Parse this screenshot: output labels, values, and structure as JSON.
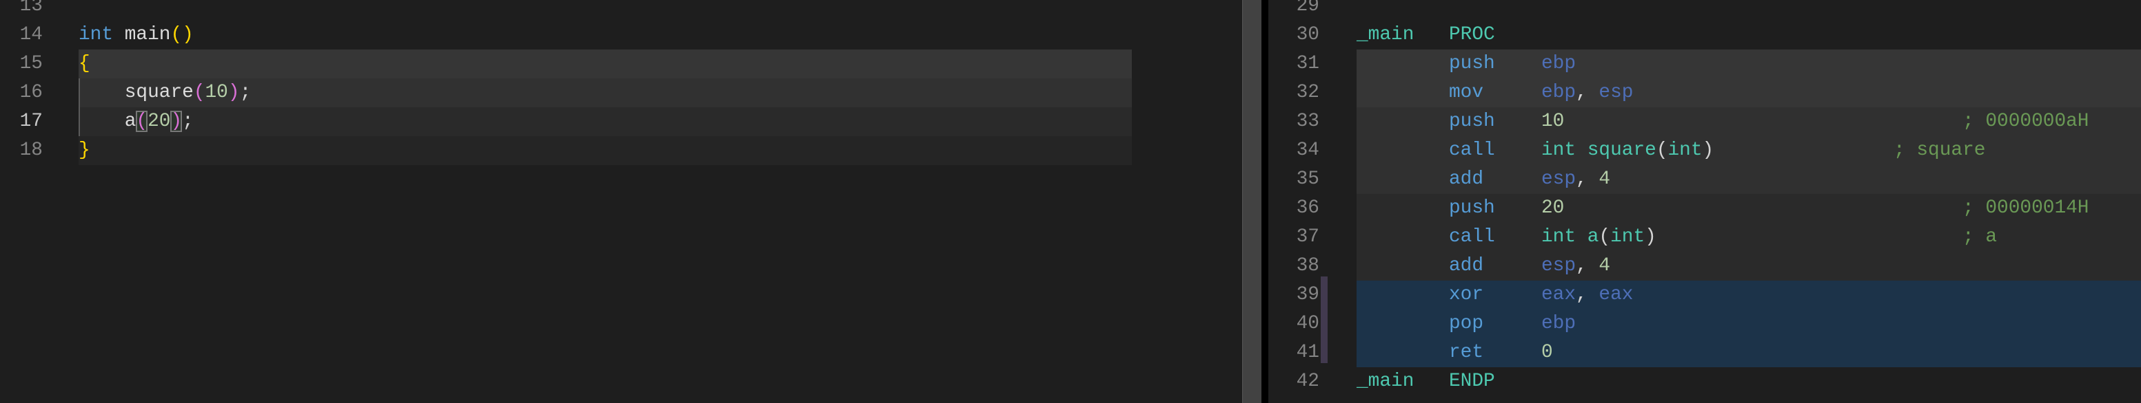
{
  "left_editor": {
    "language": "C",
    "active_line": 17,
    "lines": [
      {
        "number": 13,
        "tokens": []
      },
      {
        "number": 14,
        "tokens": [
          {
            "text": "int",
            "kind": "kw"
          },
          {
            "text": " ",
            "kind": "punc"
          },
          {
            "text": "main",
            "kind": "fn"
          },
          {
            "text": "()",
            "kind": "br1"
          }
        ]
      },
      {
        "number": 15,
        "tokens": [
          {
            "text": "{",
            "kind": "br1"
          }
        ]
      },
      {
        "number": 16,
        "tokens": [
          {
            "text": "    square",
            "kind": "fn"
          },
          {
            "text": "(",
            "kind": "br2"
          },
          {
            "text": "10",
            "kind": "num"
          },
          {
            "text": ")",
            "kind": "br2"
          },
          {
            "text": ";",
            "kind": "punc"
          }
        ]
      },
      {
        "number": 17,
        "tokens": [
          {
            "text": "    a",
            "kind": "fn"
          },
          {
            "text": "(",
            "kind": "br2",
            "boxed": true
          },
          {
            "text": "20",
            "kind": "num"
          },
          {
            "text": ")",
            "kind": "br2",
            "boxed": true
          },
          {
            "text": ";",
            "kind": "punc"
          }
        ]
      },
      {
        "number": 18,
        "tokens": [
          {
            "text": "}",
            "kind": "br1"
          }
        ]
      }
    ]
  },
  "right_editor": {
    "language": "MASM disassembly",
    "lines": [
      {
        "number": 29,
        "label": "",
        "mnemonic": "",
        "operands": [],
        "comment": ""
      },
      {
        "number": 30,
        "label": "_main",
        "mnemonic": "PROC",
        "mnemonic_kind": "label",
        "operands": [],
        "comment": ""
      },
      {
        "number": 31,
        "label": "",
        "mnemonic": "push",
        "operands": [
          {
            "text": "ebp",
            "kind": "reg"
          }
        ],
        "comment": ""
      },
      {
        "number": 32,
        "label": "",
        "mnemonic": "mov",
        "operands": [
          {
            "text": "ebp",
            "kind": "reg"
          },
          {
            "text": ", ",
            "kind": "punc"
          },
          {
            "text": "esp",
            "kind": "reg"
          }
        ],
        "comment": ""
      },
      {
        "number": 33,
        "label": "",
        "mnemonic": "push",
        "operands": [
          {
            "text": "10",
            "kind": "num"
          }
        ],
        "comment": "; 0000000aH",
        "comment_col": "far"
      },
      {
        "number": 34,
        "label": "",
        "mnemonic": "call",
        "operands": [
          {
            "text": "int square",
            "kind": "sym"
          },
          {
            "text": "(",
            "kind": "punc"
          },
          {
            "text": "int",
            "kind": "sym"
          },
          {
            "text": ")",
            "kind": "punc"
          }
        ],
        "comment": "; square",
        "comment_col": "near"
      },
      {
        "number": 35,
        "label": "",
        "mnemonic": "add",
        "operands": [
          {
            "text": "esp",
            "kind": "reg"
          },
          {
            "text": ", ",
            "kind": "punc"
          },
          {
            "text": "4",
            "kind": "num"
          }
        ],
        "comment": ""
      },
      {
        "number": 36,
        "label": "",
        "mnemonic": "push",
        "operands": [
          {
            "text": "20",
            "kind": "num"
          }
        ],
        "comment": "; 00000014H",
        "comment_col": "far"
      },
      {
        "number": 37,
        "label": "",
        "mnemonic": "call",
        "operands": [
          {
            "text": "int a",
            "kind": "sym"
          },
          {
            "text": "(",
            "kind": "punc"
          },
          {
            "text": "int",
            "kind": "sym"
          },
          {
            "text": ")",
            "kind": "punc"
          }
        ],
        "comment": "; a",
        "comment_col": "far"
      },
      {
        "number": 38,
        "label": "",
        "mnemonic": "add",
        "operands": [
          {
            "text": "esp",
            "kind": "reg"
          },
          {
            "text": ", ",
            "kind": "punc"
          },
          {
            "text": "4",
            "kind": "num"
          }
        ],
        "comment": ""
      },
      {
        "number": 39,
        "label": "",
        "mnemonic": "xor",
        "operands": [
          {
            "text": "eax",
            "kind": "reg"
          },
          {
            "text": ", ",
            "kind": "punc"
          },
          {
            "text": "eax",
            "kind": "reg"
          }
        ],
        "comment": ""
      },
      {
        "number": 40,
        "label": "",
        "mnemonic": "pop",
        "operands": [
          {
            "text": "ebp",
            "kind": "reg"
          }
        ],
        "comment": ""
      },
      {
        "number": 41,
        "label": "",
        "mnemonic": "ret",
        "operands": [
          {
            "text": "0",
            "kind": "num"
          }
        ],
        "comment": ""
      },
      {
        "number": 42,
        "label": "_main",
        "mnemonic": "ENDP",
        "mnemonic_kind": "label",
        "operands": [],
        "comment": ""
      }
    ],
    "highlight_groups": [
      {
        "lines": [
          31,
          32
        ],
        "color": "#363636"
      },
      {
        "lines": [
          33,
          34,
          35
        ],
        "color": "#303030"
      },
      {
        "lines": [
          36,
          37,
          38
        ],
        "color": "#2a2a2a"
      },
      {
        "lines": [
          39,
          40,
          41
        ],
        "color": "#1c3349"
      }
    ]
  },
  "left_highlight_groups": [
    {
      "lines": [
        15
      ],
      "color": "#363636"
    },
    {
      "lines": [
        16
      ],
      "color": "#313131"
    },
    {
      "lines": [
        17
      ],
      "color": "#2a2a2a"
    },
    {
      "lines": [
        18
      ],
      "color": "#252525"
    }
  ]
}
